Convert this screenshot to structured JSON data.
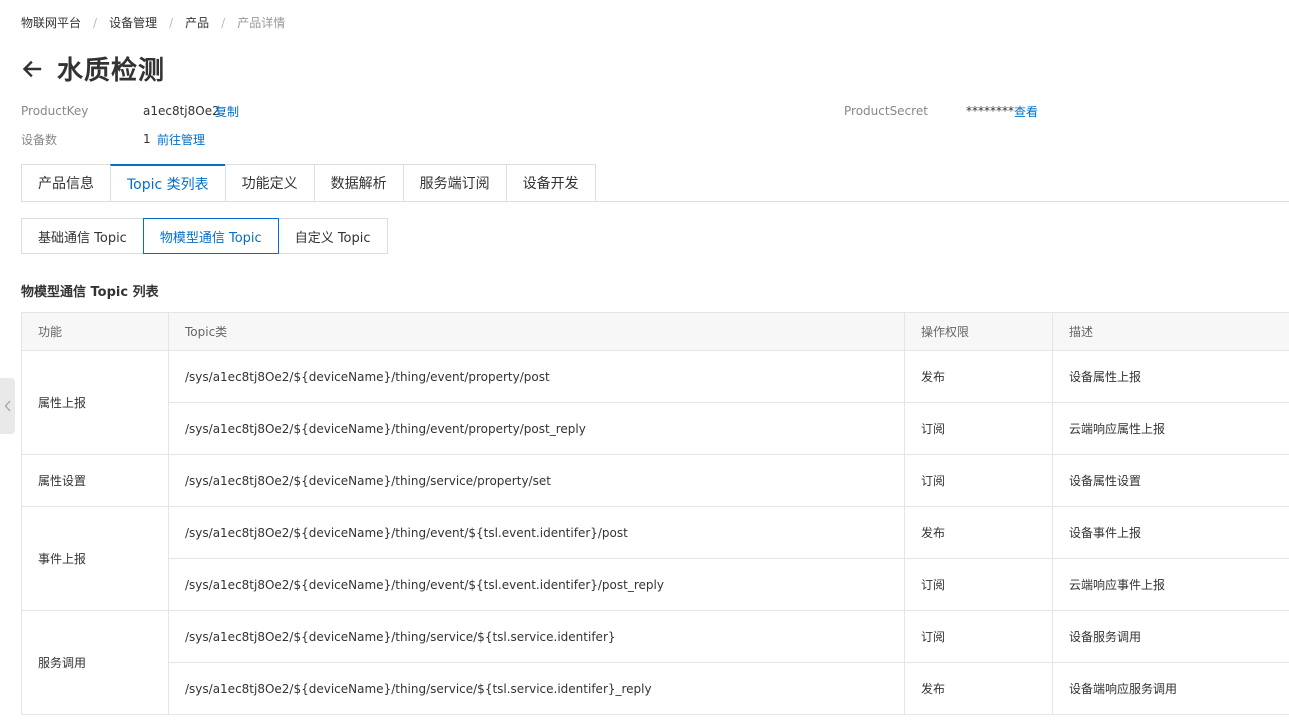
{
  "breadcrumb": [
    "物联网平台",
    "设备管理",
    "产品",
    "产品详情"
  ],
  "breadcrumb_separator": "/",
  "title": "水质检测",
  "meta": {
    "product_key_label": "ProductKey",
    "product_key_value": "a1ec8tj8Oe2",
    "copy_link": "复制",
    "device_count_label": "设备数",
    "device_count_value": "1",
    "manage_link": "前往管理",
    "product_secret_label": "ProductSecret",
    "product_secret_value": "********",
    "view_link": "查看"
  },
  "tabs": [
    "产品信息",
    "Topic 类列表",
    "功能定义",
    "数据解析",
    "服务端订阅",
    "设备开发"
  ],
  "active_tab": "Topic 类列表",
  "subtabs": [
    "基础通信 Topic",
    "物模型通信 Topic",
    "自定义 Topic"
  ],
  "active_subtab": "物模型通信 Topic",
  "section_title": "物模型通信 Topic 列表",
  "table": {
    "headers": [
      "功能",
      "Topic类",
      "操作权限",
      "描述"
    ],
    "groups": [
      {
        "function": "属性上报",
        "rows": [
          {
            "topic": "/sys/a1ec8tj8Oe2/${deviceName}/thing/event/property/post",
            "permission": "发布",
            "description": "设备属性上报"
          },
          {
            "topic": "/sys/a1ec8tj8Oe2/${deviceName}/thing/event/property/post_reply",
            "permission": "订阅",
            "description": "云端响应属性上报"
          }
        ]
      },
      {
        "function": "属性设置",
        "rows": [
          {
            "topic": "/sys/a1ec8tj8Oe2/${deviceName}/thing/service/property/set",
            "permission": "订阅",
            "description": "设备属性设置"
          }
        ]
      },
      {
        "function": "事件上报",
        "rows": [
          {
            "topic": "/sys/a1ec8tj8Oe2/${deviceName}/thing/event/${tsl.event.identifer}/post",
            "permission": "发布",
            "description": "设备事件上报"
          },
          {
            "topic": "/sys/a1ec8tj8Oe2/${deviceName}/thing/event/${tsl.event.identifer}/post_reply",
            "permission": "订阅",
            "description": "云端响应事件上报"
          }
        ]
      },
      {
        "function": "服务调用",
        "rows": [
          {
            "topic": "/sys/a1ec8tj8Oe2/${deviceName}/thing/service/${tsl.service.identifer}",
            "permission": "订阅",
            "description": "设备服务调用"
          },
          {
            "topic": "/sys/a1ec8tj8Oe2/${deviceName}/thing/service/${tsl.service.identifer}_reply",
            "permission": "发布",
            "description": "设备端响应服务调用"
          }
        ]
      }
    ]
  },
  "colors": {
    "link": "#0070cc",
    "border": "#e5e5e5",
    "header_bg": "#f7f7f7"
  },
  "icons": {
    "back": "arrow-left-icon",
    "side_toggle": "chevron-left-icon"
  }
}
